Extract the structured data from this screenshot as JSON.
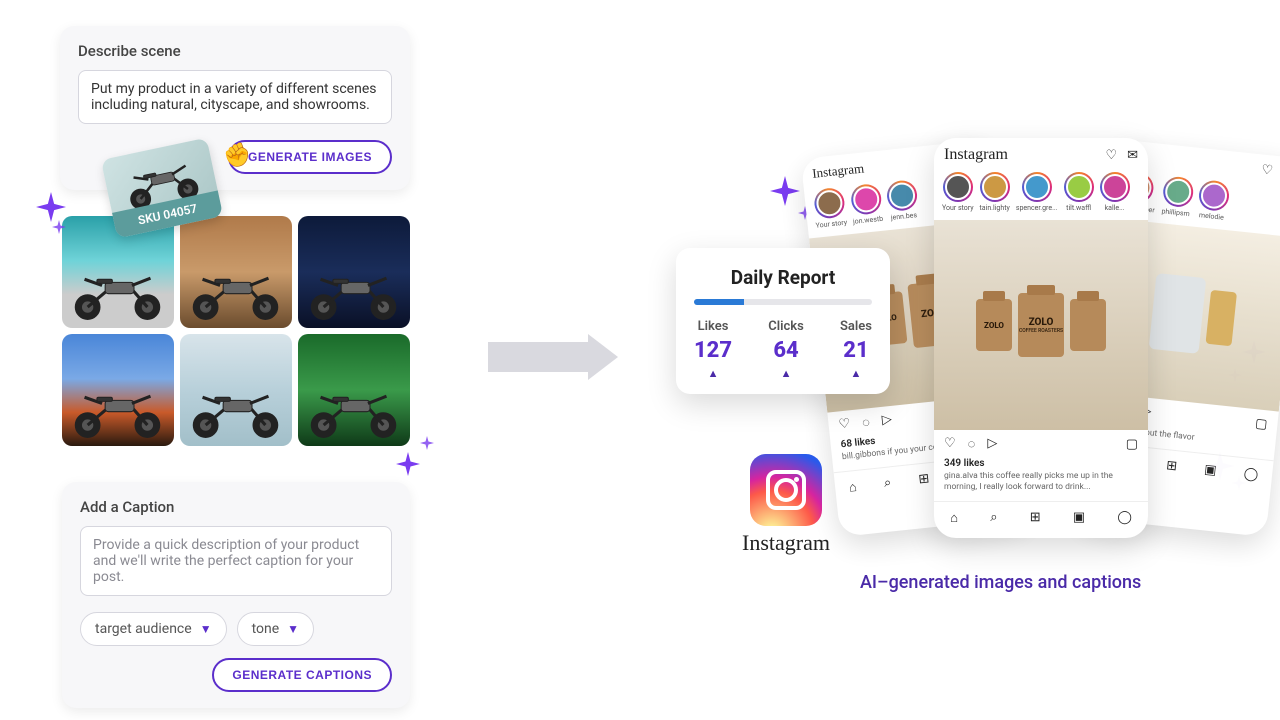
{
  "describe": {
    "title": "Describe scene",
    "value": "Put my product in a variety of different scenes including natural, cityscape, and showrooms.",
    "button": "GENERATE IMAGES",
    "sku": "SKU 04057"
  },
  "caption": {
    "title": "Add a Caption",
    "placeholder": "Provide a quick description of your product and we'll write the perfect caption for your post.",
    "audience": "target audience",
    "tone": "tone",
    "button": "GENERATE CAPTIONS"
  },
  "report": {
    "title": "Daily Report",
    "metrics": [
      {
        "label": "Likes",
        "value": "127"
      },
      {
        "label": "Clicks",
        "value": "64"
      },
      {
        "label": "Sales",
        "value": "21"
      }
    ]
  },
  "instagram": {
    "brand": "Instagram",
    "tagline": "AI–generated images and captions",
    "phones": {
      "left": {
        "stories": [
          "Your story",
          "jon.westb"
        ],
        "likes": "68 likes",
        "caption": "bill.gibbons if you your coffee, loo"
      },
      "center": {
        "stories": [
          "Your story",
          "tain.lighty",
          "spencer.gre...",
          "tilt.waffl",
          "kalle..."
        ],
        "likes": "349 likes",
        "caption": "gina.alva this coffee really picks me up in the morning, I really look forward to drink...",
        "product": "ZOLO",
        "subline": "COFFEE ROASTERS"
      },
      "right": {
        "stories": [
          "gingerb rber",
          "phillipsm",
          "melodie"
        ],
        "caption": "s coffee into out the flavor"
      }
    }
  }
}
